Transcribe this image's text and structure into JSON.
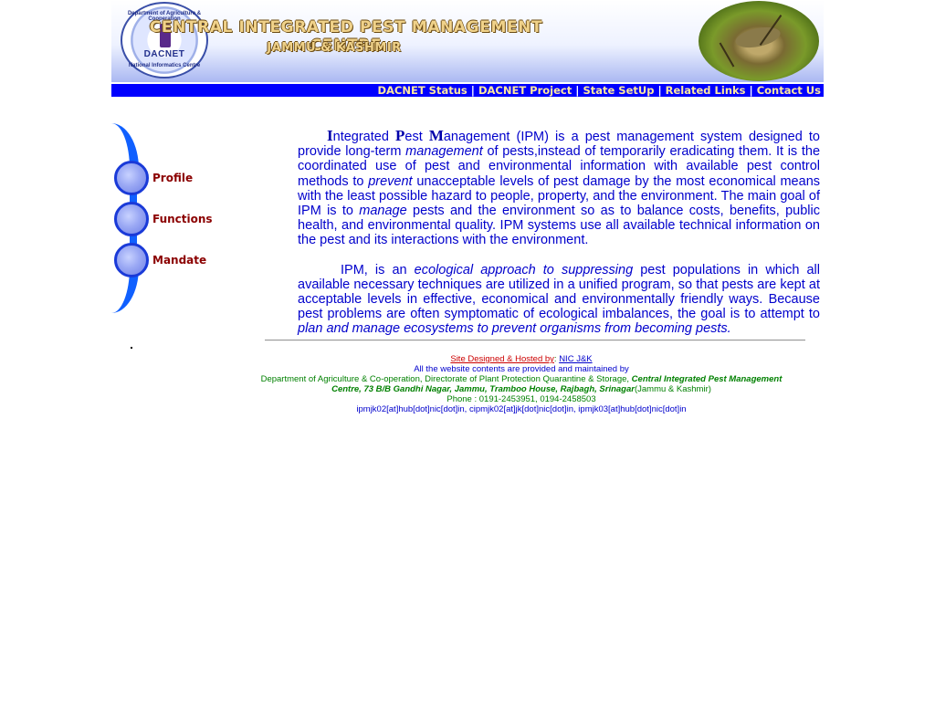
{
  "header": {
    "logo_text": "DACNET",
    "logo_ring_top": "Department of Agriculture & Cooperation",
    "logo_ring_bottom": "National Informatics Centre",
    "title": "CENTRAL INTEGRATED PEST MANAGEMENT CENTRE",
    "subtitle": "JAMMU & KASHMIR"
  },
  "nav": {
    "items": [
      {
        "label": "DACNET Status"
      },
      {
        "label": "DACNET Project"
      },
      {
        "label": "State SetUp"
      },
      {
        "label": "Related Links"
      },
      {
        "label": "Contact Us"
      }
    ],
    "separator": "|"
  },
  "menu": {
    "items": [
      {
        "label": "Profile"
      },
      {
        "label": "Functions"
      },
      {
        "label": "Mandate"
      }
    ]
  },
  "content": {
    "p1": {
      "cap_I": "I",
      "t1": "ntegrated ",
      "cap_P": "P",
      "t2": "est ",
      "cap_M": "M",
      "t3": "anagement (IPM) is a pest management system designed to provide long-term ",
      "em1": "management",
      "t4": " of pests,instead of  temporarily eradicating  them. It is the coordinated use of pest and environmental information with available pest control methods to ",
      "em2": "prevent",
      "t5": " unacceptable levels of pest damage   by the most economical means with the least possible hazard to people, property, and the environment. The main goal of IPM is to ",
      "em3": "manage",
      "t6": " pests and the environment so as to balance costs, benefits, public health, and  environmental quality. IPM systems use all available technical information on the pest and its interactions with  the environment."
    },
    "p2": {
      "t1": "IPM, is an ",
      "em1": "ecological approach to suppressing",
      "t2": " pest populations in which   all available necessary  techniques are utilized in a unified program, so that  pests are kept at acceptable levels in effective,  economical and environmentally friendly ways. Because pest problems are often symptomatic of ecological  imbalances, the goal is to attempt to ",
      "em2": "plan and manage ecosystems to prevent organisms from becoming  pests."
    }
  },
  "footer": {
    "designed_label": "Site Designed & Hosted by",
    "colon": ":",
    "nic_link": "NIC J&K",
    "line2": "All the website contents are  provided and maintained by",
    "line3_a": "Department of Agriculture & Co-operation, Directorate of Plant Protection Quarantine & Storage, ",
    "line3_b": "Central Integrated Pest Management",
    "line4_a": "Centre, 73 B/B Gandhi Nagar, Jammu,  Tramboo House, Rajbagh, Srinagar",
    "line4_b": "(Jammu & Kashmir)",
    "phone": "Phone : 0191-2453951, 0194-2458503",
    "emails": "ipmjk02[at]hub[dot]nic[dot]in, cipmjk02[at]jk[dot]nic[dot]in,  ipmjk03[at]hub[dot]nic[dot]in"
  },
  "colors": {
    "nav_bg": "#0000ff",
    "nav_text": "#ffe8a0",
    "menu_text": "#8b0000",
    "body_text": "#0000cc",
    "footer_text": "#008000"
  }
}
